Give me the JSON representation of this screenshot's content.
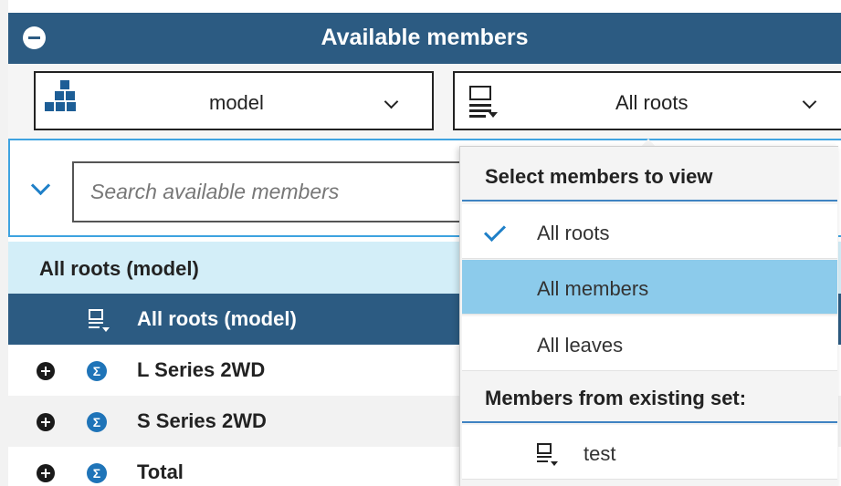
{
  "panel": {
    "title": "Available members"
  },
  "toolbar": {
    "hierarchy_select": "model",
    "filter_select": "All roots"
  },
  "search": {
    "placeholder": "Search available members"
  },
  "tree": {
    "header": "All roots (model)",
    "rows": [
      {
        "label": "All roots (model)",
        "icon": "set-icon",
        "selected": true
      },
      {
        "label": "L Series 2WD",
        "icon": "sigma-icon",
        "expandable": true
      },
      {
        "label": "S Series 2WD",
        "icon": "sigma-icon",
        "expandable": true
      },
      {
        "label": "Total",
        "icon": "sigma-icon",
        "expandable": true
      }
    ]
  },
  "dropdown": {
    "heading": "Select members to view",
    "options": [
      {
        "label": "All roots",
        "checked": true
      },
      {
        "label": "All members",
        "highlighted": true
      },
      {
        "label": "All leaves"
      }
    ],
    "existing_heading": "Members from existing set:",
    "sets": [
      {
        "label": "test",
        "icon": "set-icon"
      }
    ]
  },
  "colors": {
    "header_bg": "#2c5b82",
    "accent": "#3ea3e0",
    "highlight": "#8ccbeb",
    "tree_header_bg": "#d3eef8"
  }
}
